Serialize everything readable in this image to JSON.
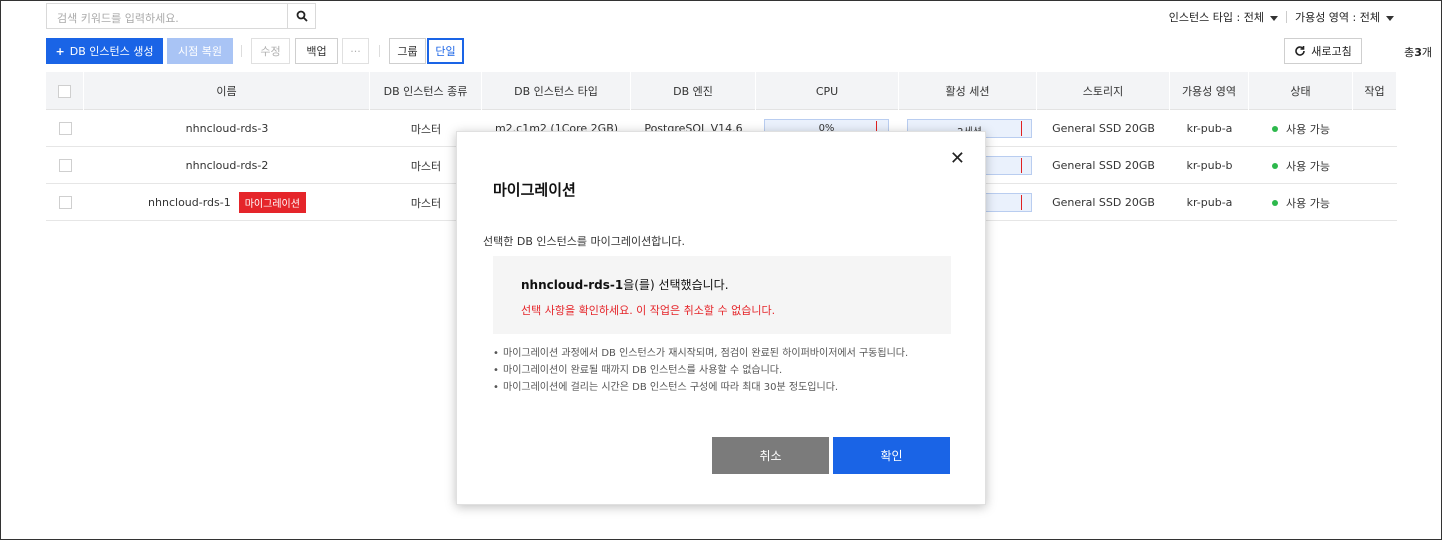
{
  "search": {
    "placeholder": "검색 키워드를 입력하세요."
  },
  "filters": {
    "instance_type": "인스턴스 타입 : 전체",
    "availability_zone": "가용성 영역 : 전체"
  },
  "toolbar": {
    "create": "DB 인스턴스 생성",
    "restore": "시점 복원",
    "modify": "수정",
    "backup": "백업",
    "more": "···",
    "group": "그룹",
    "single": "단일",
    "refresh": "새로고침",
    "total_prefix": "총",
    "total_count": "3",
    "total_suffix": "개"
  },
  "table": {
    "headers": [
      "이름",
      "DB 인스턴스 종류",
      "DB 인스턴스 타입",
      "DB 엔진",
      "CPU",
      "활성 세션",
      "스토리지",
      "가용성 영역",
      "상태",
      "작업"
    ],
    "rows": [
      {
        "name": "nhncloud-rds-3",
        "kind": "마스터",
        "type": "m2.c1m2 (1Core 2GB)",
        "engine": "PostgreSQL V14.6",
        "cpu": "0%",
        "session": "2세션",
        "storage": "General SSD 20GB",
        "az": "kr-pub-a",
        "status": "사용 가능",
        "badge": ""
      },
      {
        "name": "nhncloud-rds-2",
        "kind": "마스터",
        "type": "",
        "engine": "",
        "cpu": "",
        "session": "",
        "storage": "General SSD 20GB",
        "az": "kr-pub-b",
        "status": "사용 가능",
        "badge": ""
      },
      {
        "name": "nhncloud-rds-1",
        "kind": "마스터",
        "type": "",
        "engine": "",
        "cpu": "",
        "session": "",
        "storage": "General SSD 20GB",
        "az": "kr-pub-a",
        "status": "사용 가능",
        "badge": "마이그레이션"
      }
    ]
  },
  "modal": {
    "title": "마이그레이션",
    "description": "선택한 DB 인스턴스를 마이그레이션합니다.",
    "selected_name": "nhncloud-rds-1",
    "selected_suffix": "을(를) 선택했습니다.",
    "warning": "선택 사항을 확인하세요. 이 작업은 취소할 수 없습니다.",
    "notes": [
      "마이그레이션 과정에서 DB 인스턴스가 재시작되며, 점검이 완료된 하이퍼바이저에서 구동됩니다.",
      "마이그레이션이 완료될 때까지 DB 인스턴스를 사용할 수 없습니다.",
      "마이그레이션에 걸리는 시간은 DB 인스턴스 구성에 따라 최대 30분 정도입니다."
    ],
    "cancel": "취소",
    "confirm": "확인"
  },
  "colors": {
    "primary": "#1a64e6",
    "danger": "#e5252a",
    "success": "#2db84c"
  }
}
